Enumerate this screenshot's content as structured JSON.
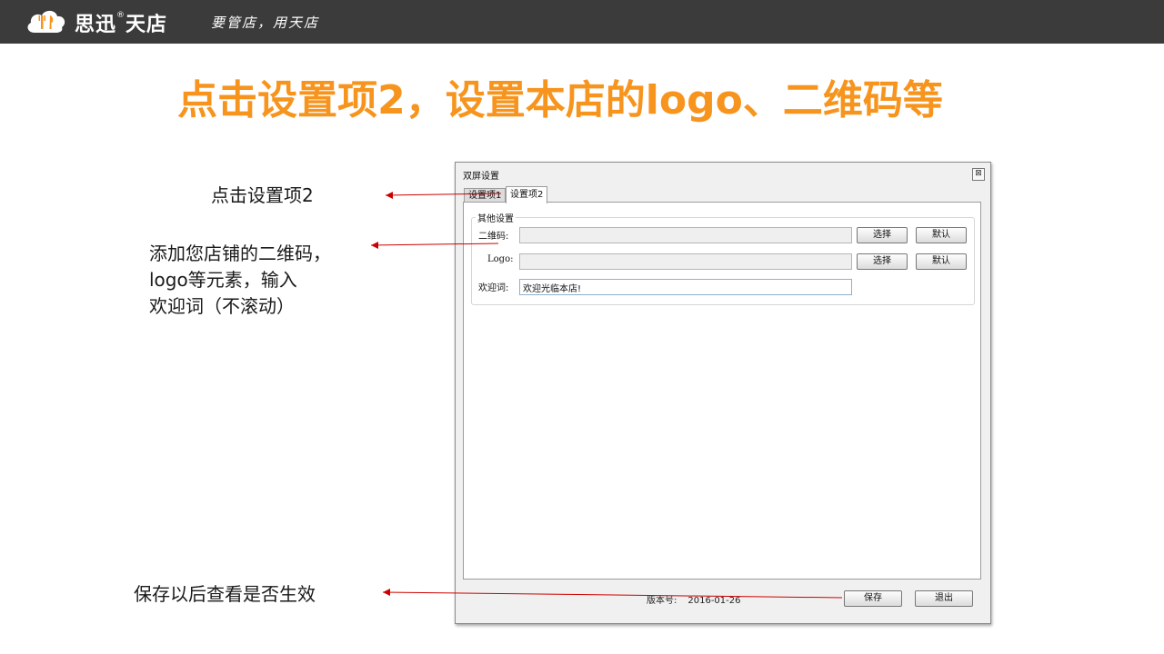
{
  "brand": {
    "name": "思迅",
    "name2": "天店",
    "registered": "®",
    "slogan": "要管店，用天店"
  },
  "title": "点击设置项2，设置本店的logo、二维码等",
  "notes": {
    "n1": "点击设置项2",
    "n2_line1": "添加您店铺的二维码，",
    "n2_line2": "logo等元素，输入",
    "n2_line3": "欢迎词（不滚动）",
    "n3": "保存以后查看是否生效"
  },
  "dialog": {
    "title": "双屏设置",
    "close": "⊠",
    "tabs": [
      "设置项1",
      "设置项2"
    ],
    "group_title": "其他设置",
    "rows": {
      "qrcode_label": "二维码:",
      "logo_label": "Logo:",
      "welcome_label": "欢迎词:",
      "welcome_value": "欢迎光临本店!"
    },
    "select_label": "选择",
    "default_label": "默认",
    "version_label": "版本号:",
    "version_value": "2016-01-26",
    "save_label": "保存",
    "exit_label": "退出"
  },
  "colors": {
    "title": "#f7941d",
    "topbar": "#3b3b3b",
    "arrow": "#cc0000"
  }
}
